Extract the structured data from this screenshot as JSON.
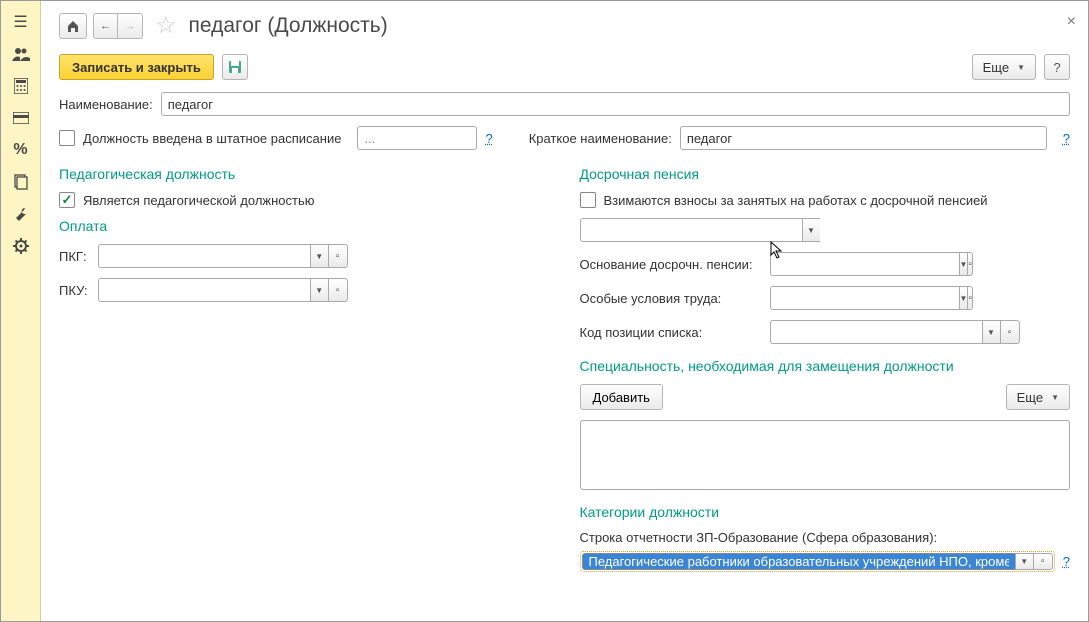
{
  "title": "педагог (Должность)",
  "toolbar": {
    "save_close": "Записать и закрыть",
    "more": "Еще",
    "help": "?"
  },
  "name": {
    "label": "Наименование:",
    "value": "педагог"
  },
  "in_staff": {
    "label": "Должность введена в штатное расписание",
    "value": "..."
  },
  "short_name": {
    "label": "Краткое наименование:",
    "value": "педагог"
  },
  "left": {
    "section": "Педагогическая должность",
    "is_ped": "Является педагогической должностью",
    "pay_section": "Оплата",
    "pkg": "ПКГ:",
    "pku": "ПКУ:"
  },
  "right": {
    "section": "Досрочная пенсия",
    "contrib": "Взимаются взносы за занятых на работах с досрочной пенсией",
    "basis": "Основание досрочн. пенсии:",
    "special": "Особые условия труда:",
    "code": "Код позиции списка:",
    "spec_section": "Специальность, необходимая для замещения должности",
    "add": "Добавить",
    "cat_section": "Категории должности",
    "zp_label": "Строка отчетности ЗП-Образование (Сфера образования):",
    "zp_value": "Педагогические работники образовательных учреждений НПО, кроме пр"
  }
}
